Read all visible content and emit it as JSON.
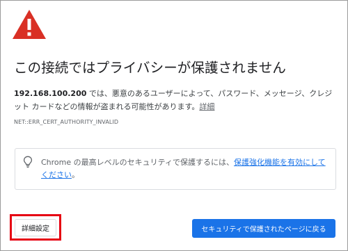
{
  "interstitial": {
    "icon": "warning-triangle-icon",
    "title": "この接続ではプライバシーが保護されません",
    "host": "192.168.100.200",
    "body_text": " では、悪意のあるユーザーによって、パスワード、メッセージ、クレジット カードなどの情報が盗まれる可能性があります。",
    "details_link": "詳細",
    "error_code": "NET::ERR_CERT_AUTHORITY_INVALID"
  },
  "tip": {
    "icon": "lightbulb-icon",
    "text": "Chrome の最高レベルのセキュリティで保護するには、",
    "link": "保護強化機能を有効にしてください",
    "suffix": "。"
  },
  "buttons": {
    "advanced": "詳細設定",
    "back_to_safety": "セキュリティで保護されたページに戻る"
  },
  "colors": {
    "warning_red": "#d93025",
    "primary_blue": "#1a73e8",
    "highlight_red": "#e60012"
  }
}
